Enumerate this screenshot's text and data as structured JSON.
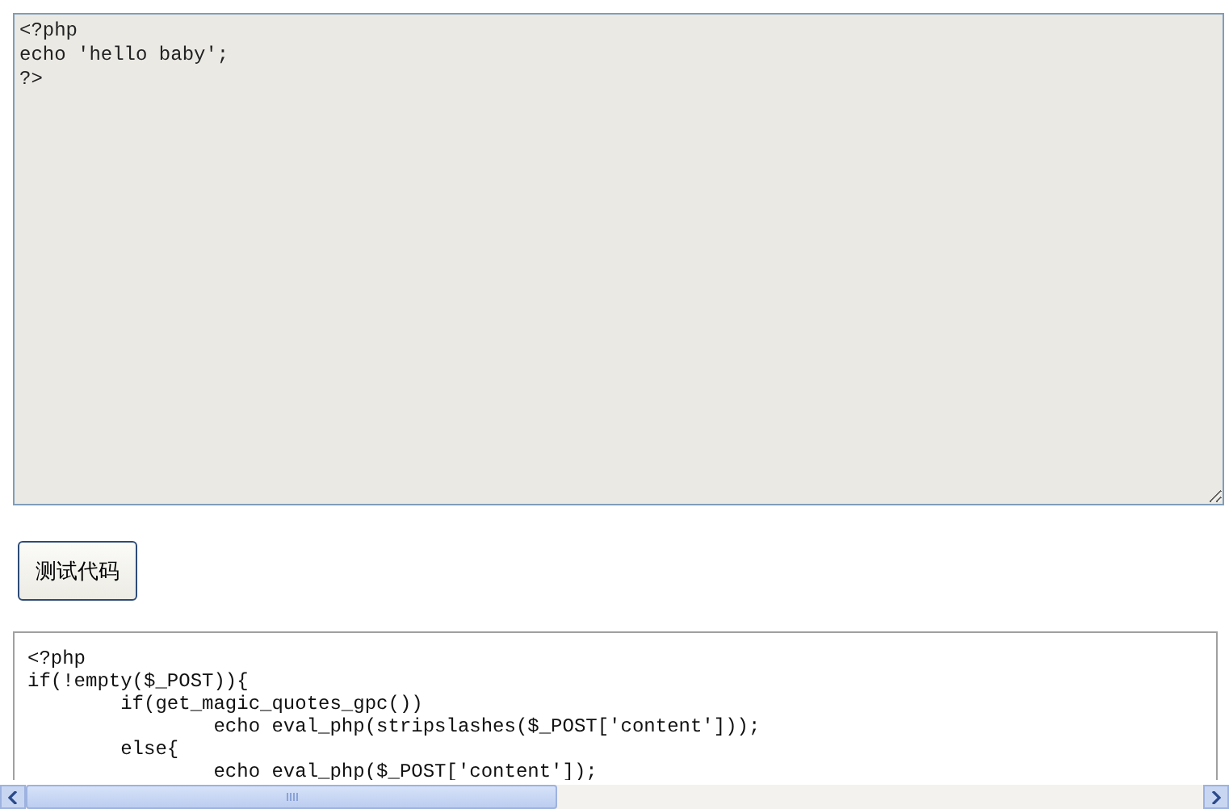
{
  "editor": {
    "value": "<?php\necho 'hello baby';\n?>"
  },
  "run_button": {
    "label": "测试代码"
  },
  "source": {
    "lines": [
      "<?php",
      "if(!empty($_POST)){",
      "\tif(get_magic_quotes_gpc())",
      "\t\techo eval_php(stripslashes($_POST['content']));",
      "\telse{",
      "\t\techo eval_php($_POST['content']);"
    ]
  }
}
